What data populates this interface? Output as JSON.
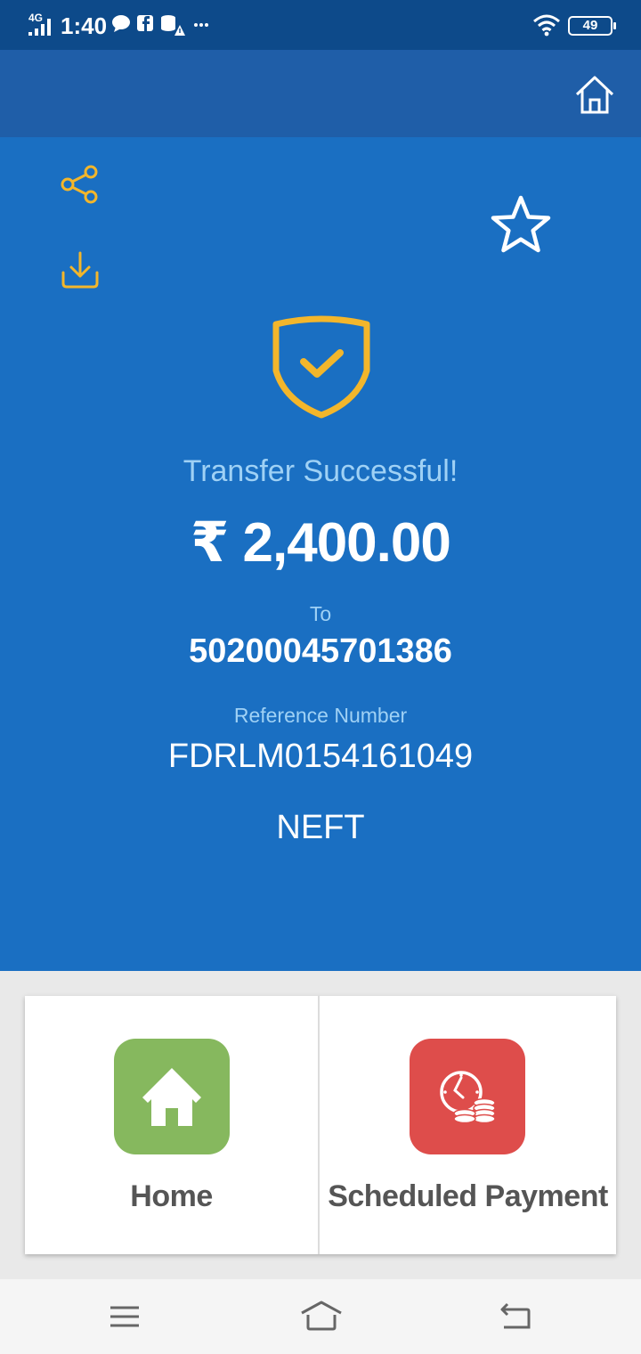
{
  "status_bar": {
    "network": "4G",
    "time": "1:40",
    "battery": "49",
    "notification_icons": [
      "chat-icon",
      "facebook-icon",
      "storage-icon",
      "alert-icon",
      "more-dots-icon"
    ]
  },
  "app_bar": {
    "home_icon": "home-outline-icon"
  },
  "actions": {
    "share_icon": "share-icon",
    "download_icon": "download-icon",
    "favorite_icon": "star-outline-icon"
  },
  "result": {
    "status_text": "Transfer Successful!",
    "amount": "₹ 2,400.00",
    "to_label": "To",
    "account_number": "50200045701386",
    "reference_label": "Reference Number",
    "reference_number": "FDRLM0154161049",
    "transfer_mode": "NEFT"
  },
  "shortcuts": [
    {
      "label": "Home",
      "icon": "house-icon",
      "color": "#86b85e"
    },
    {
      "label": "Scheduled Payment",
      "icon": "clock-coins-icon",
      "color": "#de4d4b"
    }
  ],
  "nav_bar": {
    "icons": [
      "menu-icon",
      "home-icon",
      "back-icon"
    ]
  },
  "colors": {
    "status_bar": "#0d4a8a",
    "app_bar": "#1f5ea8",
    "main_bg": "#1a6fc2",
    "accent_yellow": "#f3b62b",
    "light_blue_text": "#9fd1f5"
  }
}
